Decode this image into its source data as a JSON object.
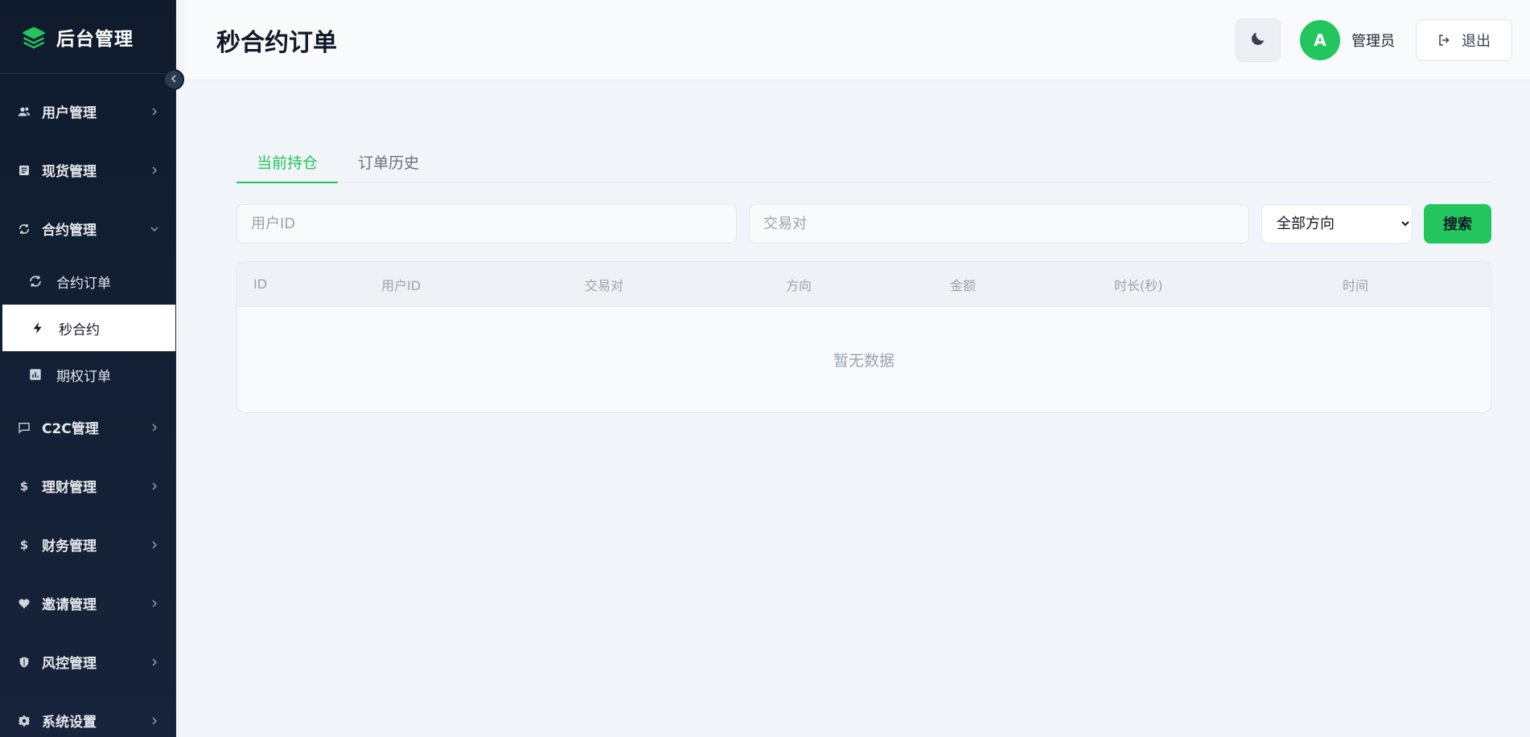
{
  "brand": {
    "title": "后台管理"
  },
  "sidebar": {
    "items": [
      {
        "label": "用户管理",
        "icon": "users-icon"
      },
      {
        "label": "现货管理",
        "icon": "list-icon"
      },
      {
        "label": "合约管理",
        "icon": "refresh-icon",
        "expanded": true,
        "children": [
          {
            "label": "合约订单",
            "icon": "refresh-icon"
          },
          {
            "label": "秒合约",
            "icon": "lightning-icon",
            "active": true
          },
          {
            "label": "期权订单",
            "icon": "bar-chart-icon"
          }
        ]
      },
      {
        "label": "C2C管理",
        "icon": "message-icon"
      },
      {
        "label": "理财管理",
        "icon": "dollar-icon"
      },
      {
        "label": "财务管理",
        "icon": "dollar-icon"
      },
      {
        "label": "邀请管理",
        "icon": "heart-icon"
      },
      {
        "label": "风控管理",
        "icon": "shield-icon"
      },
      {
        "label": "系统设置",
        "icon": "gear-icon"
      }
    ]
  },
  "header": {
    "title": "秒合约订单",
    "avatar_letter": "A",
    "username": "管理员",
    "logout_label": "退出"
  },
  "tabs": [
    {
      "label": "当前持仓",
      "active": true
    },
    {
      "label": "订单历史",
      "active": false
    }
  ],
  "filters": {
    "user_id_placeholder": "用户ID",
    "pair_placeholder": "交易对",
    "direction_selected": "全部方向",
    "search_label": "搜索"
  },
  "table": {
    "columns": [
      "ID",
      "用户ID",
      "交易对",
      "方向",
      "金额",
      "时长(秒)",
      "时间"
    ],
    "empty_text": "暂无数据"
  },
  "colors": {
    "accent": "#22c55e",
    "sidebar_bg": "#0f1b2d"
  }
}
